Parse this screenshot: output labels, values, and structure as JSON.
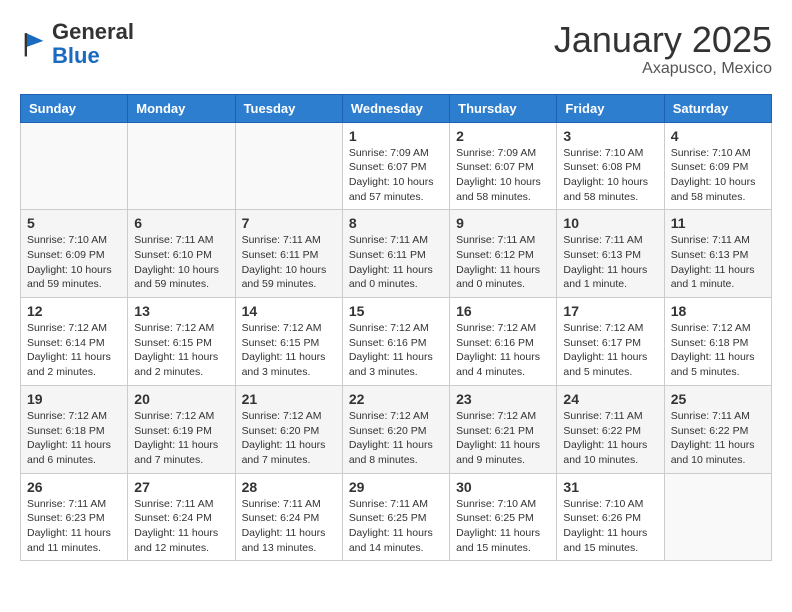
{
  "logo": {
    "general": "General",
    "blue": "Blue"
  },
  "header": {
    "month": "January 2025",
    "location": "Axapusco, Mexico"
  },
  "weekdays": [
    "Sunday",
    "Monday",
    "Tuesday",
    "Wednesday",
    "Thursday",
    "Friday",
    "Saturday"
  ],
  "weeks": [
    [
      {
        "day": "",
        "info": ""
      },
      {
        "day": "",
        "info": ""
      },
      {
        "day": "",
        "info": ""
      },
      {
        "day": "1",
        "info": "Sunrise: 7:09 AM\nSunset: 6:07 PM\nDaylight: 10 hours and 57 minutes."
      },
      {
        "day": "2",
        "info": "Sunrise: 7:09 AM\nSunset: 6:07 PM\nDaylight: 10 hours and 58 minutes."
      },
      {
        "day": "3",
        "info": "Sunrise: 7:10 AM\nSunset: 6:08 PM\nDaylight: 10 hours and 58 minutes."
      },
      {
        "day": "4",
        "info": "Sunrise: 7:10 AM\nSunset: 6:09 PM\nDaylight: 10 hours and 58 minutes."
      }
    ],
    [
      {
        "day": "5",
        "info": "Sunrise: 7:10 AM\nSunset: 6:09 PM\nDaylight: 10 hours and 59 minutes."
      },
      {
        "day": "6",
        "info": "Sunrise: 7:11 AM\nSunset: 6:10 PM\nDaylight: 10 hours and 59 minutes."
      },
      {
        "day": "7",
        "info": "Sunrise: 7:11 AM\nSunset: 6:11 PM\nDaylight: 10 hours and 59 minutes."
      },
      {
        "day": "8",
        "info": "Sunrise: 7:11 AM\nSunset: 6:11 PM\nDaylight: 11 hours and 0 minutes."
      },
      {
        "day": "9",
        "info": "Sunrise: 7:11 AM\nSunset: 6:12 PM\nDaylight: 11 hours and 0 minutes."
      },
      {
        "day": "10",
        "info": "Sunrise: 7:11 AM\nSunset: 6:13 PM\nDaylight: 11 hours and 1 minute."
      },
      {
        "day": "11",
        "info": "Sunrise: 7:11 AM\nSunset: 6:13 PM\nDaylight: 11 hours and 1 minute."
      }
    ],
    [
      {
        "day": "12",
        "info": "Sunrise: 7:12 AM\nSunset: 6:14 PM\nDaylight: 11 hours and 2 minutes."
      },
      {
        "day": "13",
        "info": "Sunrise: 7:12 AM\nSunset: 6:15 PM\nDaylight: 11 hours and 2 minutes."
      },
      {
        "day": "14",
        "info": "Sunrise: 7:12 AM\nSunset: 6:15 PM\nDaylight: 11 hours and 3 minutes."
      },
      {
        "day": "15",
        "info": "Sunrise: 7:12 AM\nSunset: 6:16 PM\nDaylight: 11 hours and 3 minutes."
      },
      {
        "day": "16",
        "info": "Sunrise: 7:12 AM\nSunset: 6:16 PM\nDaylight: 11 hours and 4 minutes."
      },
      {
        "day": "17",
        "info": "Sunrise: 7:12 AM\nSunset: 6:17 PM\nDaylight: 11 hours and 5 minutes."
      },
      {
        "day": "18",
        "info": "Sunrise: 7:12 AM\nSunset: 6:18 PM\nDaylight: 11 hours and 5 minutes."
      }
    ],
    [
      {
        "day": "19",
        "info": "Sunrise: 7:12 AM\nSunset: 6:18 PM\nDaylight: 11 hours and 6 minutes."
      },
      {
        "day": "20",
        "info": "Sunrise: 7:12 AM\nSunset: 6:19 PM\nDaylight: 11 hours and 7 minutes."
      },
      {
        "day": "21",
        "info": "Sunrise: 7:12 AM\nSunset: 6:20 PM\nDaylight: 11 hours and 7 minutes."
      },
      {
        "day": "22",
        "info": "Sunrise: 7:12 AM\nSunset: 6:20 PM\nDaylight: 11 hours and 8 minutes."
      },
      {
        "day": "23",
        "info": "Sunrise: 7:12 AM\nSunset: 6:21 PM\nDaylight: 11 hours and 9 minutes."
      },
      {
        "day": "24",
        "info": "Sunrise: 7:11 AM\nSunset: 6:22 PM\nDaylight: 11 hours and 10 minutes."
      },
      {
        "day": "25",
        "info": "Sunrise: 7:11 AM\nSunset: 6:22 PM\nDaylight: 11 hours and 10 minutes."
      }
    ],
    [
      {
        "day": "26",
        "info": "Sunrise: 7:11 AM\nSunset: 6:23 PM\nDaylight: 11 hours and 11 minutes."
      },
      {
        "day": "27",
        "info": "Sunrise: 7:11 AM\nSunset: 6:24 PM\nDaylight: 11 hours and 12 minutes."
      },
      {
        "day": "28",
        "info": "Sunrise: 7:11 AM\nSunset: 6:24 PM\nDaylight: 11 hours and 13 minutes."
      },
      {
        "day": "29",
        "info": "Sunrise: 7:11 AM\nSunset: 6:25 PM\nDaylight: 11 hours and 14 minutes."
      },
      {
        "day": "30",
        "info": "Sunrise: 7:10 AM\nSunset: 6:25 PM\nDaylight: 11 hours and 15 minutes."
      },
      {
        "day": "31",
        "info": "Sunrise: 7:10 AM\nSunset: 6:26 PM\nDaylight: 11 hours and 15 minutes."
      },
      {
        "day": "",
        "info": ""
      }
    ]
  ]
}
